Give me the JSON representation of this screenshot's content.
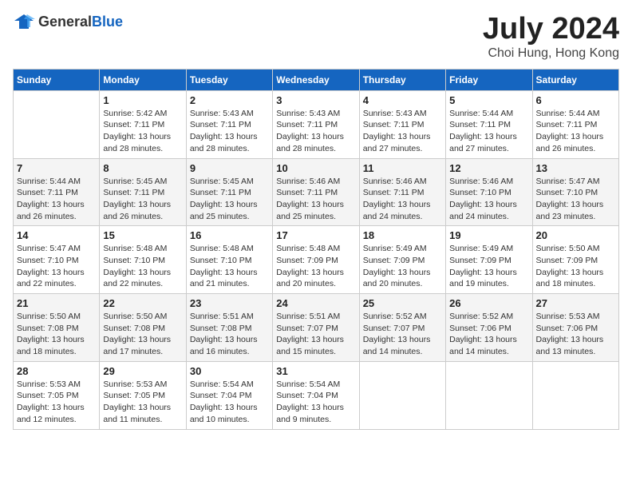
{
  "header": {
    "logo_general": "General",
    "logo_blue": "Blue",
    "month_year": "July 2024",
    "location": "Choi Hung, Hong Kong"
  },
  "weekdays": [
    "Sunday",
    "Monday",
    "Tuesday",
    "Wednesday",
    "Thursday",
    "Friday",
    "Saturday"
  ],
  "weeks": [
    [
      {
        "day": "",
        "sunrise": "",
        "sunset": "",
        "daylight": "",
        "empty": true
      },
      {
        "day": "1",
        "sunrise": "Sunrise: 5:42 AM",
        "sunset": "Sunset: 7:11 PM",
        "daylight": "Daylight: 13 hours and 28 minutes."
      },
      {
        "day": "2",
        "sunrise": "Sunrise: 5:43 AM",
        "sunset": "Sunset: 7:11 PM",
        "daylight": "Daylight: 13 hours and 28 minutes."
      },
      {
        "day": "3",
        "sunrise": "Sunrise: 5:43 AM",
        "sunset": "Sunset: 7:11 PM",
        "daylight": "Daylight: 13 hours and 28 minutes."
      },
      {
        "day": "4",
        "sunrise": "Sunrise: 5:43 AM",
        "sunset": "Sunset: 7:11 PM",
        "daylight": "Daylight: 13 hours and 27 minutes."
      },
      {
        "day": "5",
        "sunrise": "Sunrise: 5:44 AM",
        "sunset": "Sunset: 7:11 PM",
        "daylight": "Daylight: 13 hours and 27 minutes."
      },
      {
        "day": "6",
        "sunrise": "Sunrise: 5:44 AM",
        "sunset": "Sunset: 7:11 PM",
        "daylight": "Daylight: 13 hours and 26 minutes."
      }
    ],
    [
      {
        "day": "7",
        "sunrise": "Sunrise: 5:44 AM",
        "sunset": "Sunset: 7:11 PM",
        "daylight": "Daylight: 13 hours and 26 minutes."
      },
      {
        "day": "8",
        "sunrise": "Sunrise: 5:45 AM",
        "sunset": "Sunset: 7:11 PM",
        "daylight": "Daylight: 13 hours and 26 minutes."
      },
      {
        "day": "9",
        "sunrise": "Sunrise: 5:45 AM",
        "sunset": "Sunset: 7:11 PM",
        "daylight": "Daylight: 13 hours and 25 minutes."
      },
      {
        "day": "10",
        "sunrise": "Sunrise: 5:46 AM",
        "sunset": "Sunset: 7:11 PM",
        "daylight": "Daylight: 13 hours and 25 minutes."
      },
      {
        "day": "11",
        "sunrise": "Sunrise: 5:46 AM",
        "sunset": "Sunset: 7:11 PM",
        "daylight": "Daylight: 13 hours and 24 minutes."
      },
      {
        "day": "12",
        "sunrise": "Sunrise: 5:46 AM",
        "sunset": "Sunset: 7:10 PM",
        "daylight": "Daylight: 13 hours and 24 minutes."
      },
      {
        "day": "13",
        "sunrise": "Sunrise: 5:47 AM",
        "sunset": "Sunset: 7:10 PM",
        "daylight": "Daylight: 13 hours and 23 minutes."
      }
    ],
    [
      {
        "day": "14",
        "sunrise": "Sunrise: 5:47 AM",
        "sunset": "Sunset: 7:10 PM",
        "daylight": "Daylight: 13 hours and 22 minutes."
      },
      {
        "day": "15",
        "sunrise": "Sunrise: 5:48 AM",
        "sunset": "Sunset: 7:10 PM",
        "daylight": "Daylight: 13 hours and 22 minutes."
      },
      {
        "day": "16",
        "sunrise": "Sunrise: 5:48 AM",
        "sunset": "Sunset: 7:10 PM",
        "daylight": "Daylight: 13 hours and 21 minutes."
      },
      {
        "day": "17",
        "sunrise": "Sunrise: 5:48 AM",
        "sunset": "Sunset: 7:09 PM",
        "daylight": "Daylight: 13 hours and 20 minutes."
      },
      {
        "day": "18",
        "sunrise": "Sunrise: 5:49 AM",
        "sunset": "Sunset: 7:09 PM",
        "daylight": "Daylight: 13 hours and 20 minutes."
      },
      {
        "day": "19",
        "sunrise": "Sunrise: 5:49 AM",
        "sunset": "Sunset: 7:09 PM",
        "daylight": "Daylight: 13 hours and 19 minutes."
      },
      {
        "day": "20",
        "sunrise": "Sunrise: 5:50 AM",
        "sunset": "Sunset: 7:09 PM",
        "daylight": "Daylight: 13 hours and 18 minutes."
      }
    ],
    [
      {
        "day": "21",
        "sunrise": "Sunrise: 5:50 AM",
        "sunset": "Sunset: 7:08 PM",
        "daylight": "Daylight: 13 hours and 18 minutes."
      },
      {
        "day": "22",
        "sunrise": "Sunrise: 5:50 AM",
        "sunset": "Sunset: 7:08 PM",
        "daylight": "Daylight: 13 hours and 17 minutes."
      },
      {
        "day": "23",
        "sunrise": "Sunrise: 5:51 AM",
        "sunset": "Sunset: 7:08 PM",
        "daylight": "Daylight: 13 hours and 16 minutes."
      },
      {
        "day": "24",
        "sunrise": "Sunrise: 5:51 AM",
        "sunset": "Sunset: 7:07 PM",
        "daylight": "Daylight: 13 hours and 15 minutes."
      },
      {
        "day": "25",
        "sunrise": "Sunrise: 5:52 AM",
        "sunset": "Sunset: 7:07 PM",
        "daylight": "Daylight: 13 hours and 14 minutes."
      },
      {
        "day": "26",
        "sunrise": "Sunrise: 5:52 AM",
        "sunset": "Sunset: 7:06 PM",
        "daylight": "Daylight: 13 hours and 14 minutes."
      },
      {
        "day": "27",
        "sunrise": "Sunrise: 5:53 AM",
        "sunset": "Sunset: 7:06 PM",
        "daylight": "Daylight: 13 hours and 13 minutes."
      }
    ],
    [
      {
        "day": "28",
        "sunrise": "Sunrise: 5:53 AM",
        "sunset": "Sunset: 7:05 PM",
        "daylight": "Daylight: 13 hours and 12 minutes."
      },
      {
        "day": "29",
        "sunrise": "Sunrise: 5:53 AM",
        "sunset": "Sunset: 7:05 PM",
        "daylight": "Daylight: 13 hours and 11 minutes."
      },
      {
        "day": "30",
        "sunrise": "Sunrise: 5:54 AM",
        "sunset": "Sunset: 7:04 PM",
        "daylight": "Daylight: 13 hours and 10 minutes."
      },
      {
        "day": "31",
        "sunrise": "Sunrise: 5:54 AM",
        "sunset": "Sunset: 7:04 PM",
        "daylight": "Daylight: 13 hours and 9 minutes."
      },
      {
        "day": "",
        "sunrise": "",
        "sunset": "",
        "daylight": "",
        "empty": true
      },
      {
        "day": "",
        "sunrise": "",
        "sunset": "",
        "daylight": "",
        "empty": true
      },
      {
        "day": "",
        "sunrise": "",
        "sunset": "",
        "daylight": "",
        "empty": true
      }
    ]
  ]
}
